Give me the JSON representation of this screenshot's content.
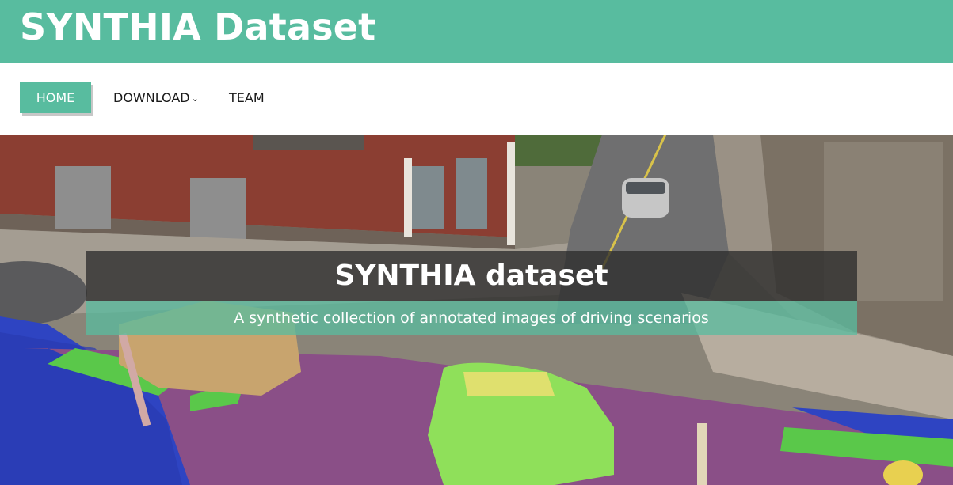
{
  "header": {
    "title": "SYNTHIA Dataset"
  },
  "nav": {
    "items": [
      {
        "label": "HOME",
        "active": true
      },
      {
        "label": "DOWNLOAD",
        "has_dropdown": true
      },
      {
        "label": "TEAM"
      }
    ]
  },
  "hero": {
    "title": "SYNTHIA dataset",
    "subtitle": "A synthetic collection of annotated images of driving scenarios"
  },
  "colors": {
    "brand": "#58bc9f",
    "caption_dark": "#2d2d2d",
    "segmentation_road": "#8a4f87",
    "segmentation_sidewalk": "#2a3fbf",
    "segmentation_car": "#8fe05a",
    "segmentation_marking": "#5ac84a"
  },
  "icons": {
    "dropdown": "chevron-down-icon"
  }
}
